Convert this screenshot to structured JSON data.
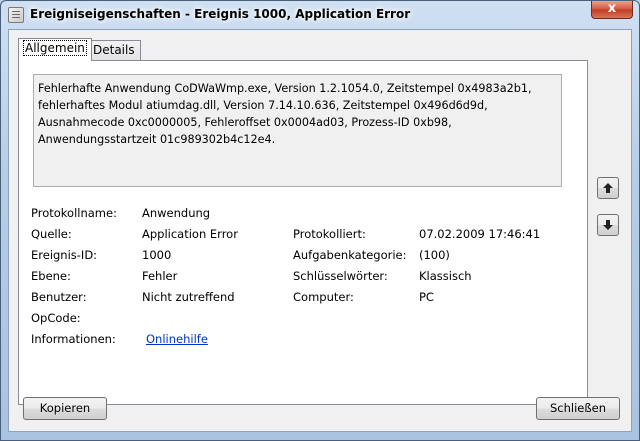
{
  "window": {
    "title": "Ereigniseigenschaften - Ereignis 1000, Application Error",
    "close_glyph": "x"
  },
  "tabs": [
    {
      "label": "Allgemein",
      "active": true
    },
    {
      "label": "Details",
      "active": false
    }
  ],
  "description": "Fehlerhafte Anwendung CoDWaWmp.exe, Version 1.2.1054.0, Zeitstempel 0x4983a2b1, fehlerhaftes Modul atiumdag.dll, Version 7.14.10.636, Zeitstempel 0x496d6d9d, Ausnahmecode 0xc0000005, Fehleroffset 0x0004ad03, Prozess-ID 0xb98, Anwendungsstartzeit 01c989302b4c12e4.",
  "fields": {
    "protokollname": {
      "label": "Protokollname:",
      "value": "Anwendung"
    },
    "quelle": {
      "label": "Quelle:",
      "value": "Application Error"
    },
    "ereignis_id": {
      "label": "Ereignis-ID:",
      "value": "1000"
    },
    "ebene": {
      "label": "Ebene:",
      "value": "Fehler"
    },
    "benutzer": {
      "label": "Benutzer:",
      "value": "Nicht zutreffend"
    },
    "opcode": {
      "label": "OpCode:",
      "value": ""
    },
    "informationen": {
      "label": "Informationen:",
      "value": "Onlinehilfe"
    },
    "protokolliert": {
      "label": "Protokolliert:",
      "value": "07.02.2009 17:46:41"
    },
    "aufgabenkategorie": {
      "label": "Aufgabenkategorie:",
      "value": "(100)"
    },
    "schluesselwoerter": {
      "label": "Schlüsselwörter:",
      "value": "Klassisch"
    },
    "computer": {
      "label": "Computer:",
      "value": "PC"
    }
  },
  "buttons": {
    "copy": "Kopieren",
    "close": "Schließen",
    "up_icon": "arrow-up-icon",
    "down_icon": "arrow-down-icon"
  },
  "colors": {
    "link": "#0033cc",
    "close_red": "#c03b1f",
    "frame_blue": "#b7cde6"
  }
}
